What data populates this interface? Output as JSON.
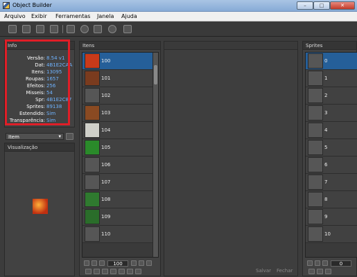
{
  "window": {
    "title": "Object Builder",
    "min_label": "–",
    "max_label": "□",
    "close_label": "✕"
  },
  "menu": [
    "Arquivo",
    "Exibir",
    "Ferramentas",
    "Janela",
    "Ajuda"
  ],
  "info": {
    "header": "Info",
    "rows": [
      {
        "label": "Versão:",
        "value": "8.54 v1"
      },
      {
        "label": "Dat:",
        "value": "4B1E2CAA"
      },
      {
        "label": "Itens:",
        "value": "13095"
      },
      {
        "label": "Roupas:",
        "value": "1657"
      },
      {
        "label": "Efeitos:",
        "value": "256"
      },
      {
        "label": "Misseis:",
        "value": "54"
      },
      {
        "label": "Spr:",
        "value": "4B1E2C87"
      },
      {
        "label": "Sprites:",
        "value": "89138"
      },
      {
        "label": "Estendido:",
        "value": "Sim"
      },
      {
        "label": "Transparência:",
        "value": "Sim"
      }
    ]
  },
  "category_select": {
    "value": "Item"
  },
  "preview": {
    "header": "Visualização"
  },
  "items": {
    "header": "Itens",
    "page_value": "100",
    "rows": [
      {
        "id": "100",
        "color": "#c83a1a",
        "selected": true
      },
      {
        "id": "101",
        "color": "#7a3b1e",
        "selected": false
      },
      {
        "id": "102",
        "color": "#5c5c5c",
        "selected": false
      },
      {
        "id": "103",
        "color": "#8a4a22",
        "selected": false
      },
      {
        "id": "104",
        "color": "#cfcfc9",
        "selected": false
      },
      {
        "id": "105",
        "color": "#2a8a2a",
        "selected": false
      },
      {
        "id": "106",
        "color": "#565656",
        "selected": false
      },
      {
        "id": "107",
        "color": "#565656",
        "selected": false
      },
      {
        "id": "108",
        "color": "#2f7a2f",
        "selected": false
      },
      {
        "id": "109",
        "color": "#2a6d2a",
        "selected": false
      },
      {
        "id": "110",
        "color": "#565656",
        "selected": false
      }
    ]
  },
  "editor": {
    "save_label": "Salvar",
    "close_label": "Fechar"
  },
  "sprites": {
    "header": "Sprites",
    "page_value": "0",
    "rows": [
      {
        "id": "0",
        "color": "#565656",
        "selected": true
      },
      {
        "id": "1",
        "color": "#565656",
        "selected": false
      },
      {
        "id": "2",
        "color": "#565656",
        "selected": false
      },
      {
        "id": "3",
        "color": "#565656",
        "selected": false
      },
      {
        "id": "4",
        "color": "#565656",
        "selected": false
      },
      {
        "id": "5",
        "color": "#565656",
        "selected": false
      },
      {
        "id": "6",
        "color": "#565656",
        "selected": false
      },
      {
        "id": "7",
        "color": "#565656",
        "selected": false
      },
      {
        "id": "8",
        "color": "#565656",
        "selected": false
      },
      {
        "id": "9",
        "color": "#565656",
        "selected": false
      },
      {
        "id": "10",
        "color": "#565656",
        "selected": false
      }
    ]
  },
  "colors": {
    "selection": "#255f99",
    "value_text": "#6fb3ff",
    "highlight_box": "#e01e27"
  }
}
